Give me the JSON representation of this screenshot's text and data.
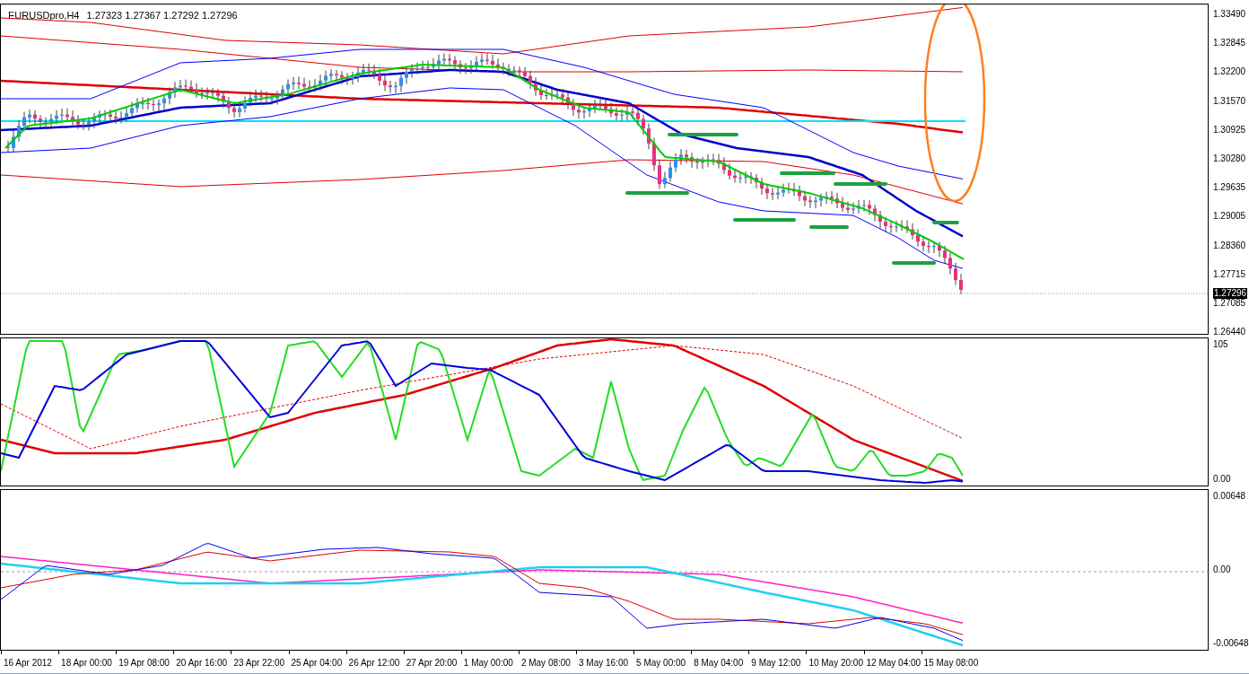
{
  "chart_header": {
    "symbol": "EURUSDpro,H4",
    "quotes": [
      "1.27323",
      "1.27367",
      "1.27292",
      "1.27296"
    ]
  },
  "price_axis": {
    "labels": [
      "1.33490",
      "1.32845",
      "1.32200",
      "1.31570",
      "1.30925",
      "1.30280",
      "1.29635",
      "1.29005",
      "1.28360",
      "1.27715",
      "1.27085",
      "1.26440"
    ],
    "current_price": "1.27296"
  },
  "oscillator_axis": {
    "labels": [
      "105",
      "0.00"
    ]
  },
  "macd_axis": {
    "labels": [
      "0.00648",
      "0.00",
      "-0.00648"
    ]
  },
  "time_axis": {
    "labels": [
      "16 Apr 2012",
      "18 Apr 00:00",
      "19 Apr 08:00",
      "20 Apr 16:00",
      "23 Apr 22:00",
      "25 Apr 04:00",
      "26 Apr 12:00",
      "27 Apr 20:00",
      "1 May 00:00",
      "2 May 08:00",
      "3 May 16:00",
      "5 May 00:00",
      "8 May 04:00",
      "9 May 12:00",
      "10 May 20:00",
      "12 May 04:00",
      "15 May 08:00"
    ]
  }
}
